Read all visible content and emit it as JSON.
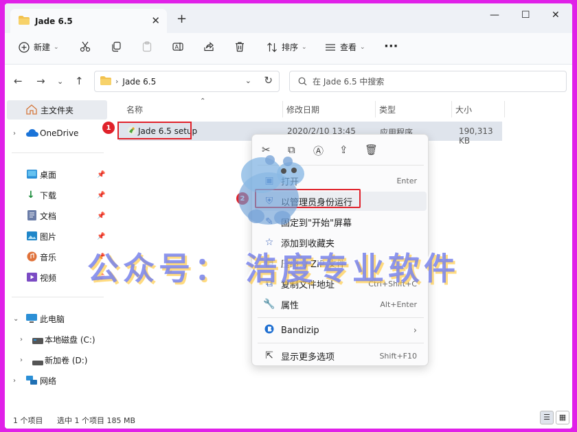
{
  "window": {
    "tab_title": "Jade 6.5",
    "tab_close": "✕",
    "tab_add": "+",
    "minimize": "—",
    "maximize": "☐",
    "close": "✕"
  },
  "toolbar": {
    "new_label": "新建",
    "sort_label": "排序",
    "view_label": "查看",
    "more": "···"
  },
  "address": {
    "crumb": "Jade 6.5",
    "search_placeholder": "在 Jade 6.5 中搜索"
  },
  "sidebar": {
    "home": "主文件夹",
    "onedrive": "OneDrive",
    "desktop": "桌面",
    "downloads": "下载",
    "documents": "文档",
    "pictures": "图片",
    "music": "音乐",
    "videos": "视频",
    "this_pc": "此电脑",
    "local_disk": "本地磁盘 (C:)",
    "new_volume": "新加卷 (D:)",
    "network": "网络"
  },
  "columns": {
    "name": "名称",
    "modified": "修改日期",
    "type": "类型",
    "size": "大小"
  },
  "file": {
    "name": "Jade 6.5 setup",
    "modified": "2020/2/10 13:45",
    "type": "应用程序",
    "size": "190,313 KB"
  },
  "badges": {
    "one": "1",
    "two": "2"
  },
  "context_menu": {
    "open": "打开",
    "open_key": "Enter",
    "run_as_admin": "以管理员身份运行",
    "pin_start": "固定到\"开始\"屏幕",
    "add_favorites": "添加到收藏夹",
    "compress_zip": "压缩为 ZIP 文件",
    "copy_path": "复制文件地址",
    "copy_path_key": "Ctrl+Shift+C",
    "properties": "属性",
    "properties_key": "Alt+Enter",
    "bandizip": "Bandizip",
    "more_options": "显示更多选项",
    "more_options_key": "Shift+F10"
  },
  "watermark": "公众号：  浩度专业软件",
  "status": {
    "items": "1 个项目",
    "selected": "选中 1 个项目  185 MB"
  },
  "colors": {
    "accent": "#3860b8",
    "highlight_red": "#e0212a",
    "frame": "#e020e8"
  }
}
